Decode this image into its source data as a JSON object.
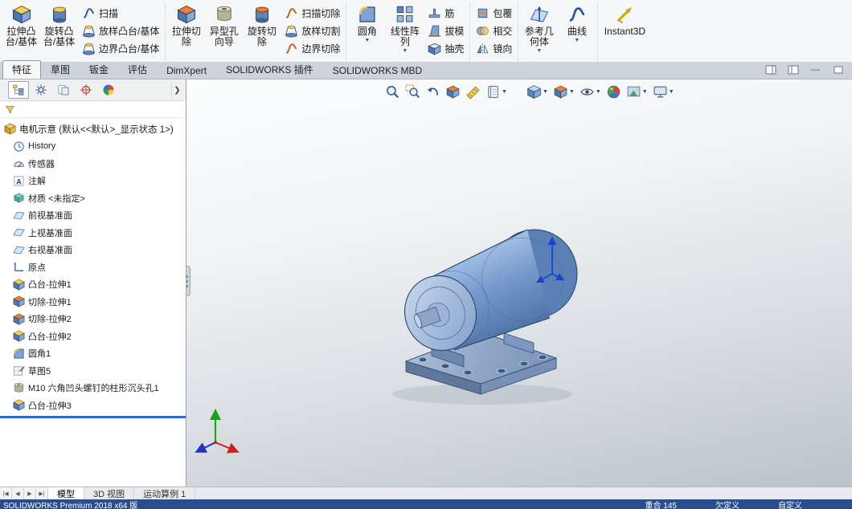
{
  "ribbon": {
    "groups": [
      {
        "big": [
          {
            "label": "拉伸凸台/基体",
            "icon": "extruded-boss-icon"
          },
          {
            "label": "旋转凸台/基体",
            "icon": "revolved-boss-icon"
          }
        ],
        "small": [
          {
            "label": "扫描",
            "icon": "sweep-icon"
          },
          {
            "label": "放样凸台/基体",
            "icon": "lofted-boss-icon"
          },
          {
            "label": "边界凸台/基体",
            "icon": "boundary-boss-icon"
          }
        ]
      },
      {
        "big": [
          {
            "label": "拉伸切除",
            "icon": "extruded-cut-icon"
          },
          {
            "label": "异型孔向导",
            "icon": "hole-wizard-icon"
          },
          {
            "label": "旋转切除",
            "icon": "revolved-cut-icon"
          }
        ],
        "small": [
          {
            "label": "扫描切除",
            "icon": "swept-cut-icon"
          },
          {
            "label": "放样切割",
            "icon": "lofted-cut-icon"
          },
          {
            "label": "边界切除",
            "icon": "boundary-cut-icon"
          }
        ]
      },
      {
        "big": [
          {
            "label": "圆角",
            "icon": "fillet-icon",
            "dropdown": true
          },
          {
            "label": "线性阵列",
            "icon": "linear-pattern-icon",
            "dropdown": true
          }
        ],
        "small": [
          {
            "label": "筋",
            "icon": "rib-icon"
          },
          {
            "label": "拔模",
            "icon": "draft-icon"
          },
          {
            "label": "抽壳",
            "icon": "shell-icon"
          }
        ]
      },
      {
        "small": [
          {
            "label": "包覆",
            "icon": "wrap-icon"
          },
          {
            "label": "相交",
            "icon": "intersect-icon"
          },
          {
            "label": "镜向",
            "icon": "mirror-icon"
          }
        ]
      },
      {
        "big": [
          {
            "label": "参考几何体",
            "icon": "reference-geometry-icon",
            "dropdown": true
          },
          {
            "label": "曲线",
            "icon": "curves-icon",
            "dropdown": true
          }
        ]
      },
      {
        "big": [
          {
            "label": "Instant3D",
            "icon": "instant3d-icon"
          }
        ]
      }
    ]
  },
  "command_tabs": [
    {
      "label": "特征",
      "active": true
    },
    {
      "label": "草图"
    },
    {
      "label": "钣金"
    },
    {
      "label": "评估"
    },
    {
      "label": "DimXpert"
    },
    {
      "label": "SOLIDWORKS 插件"
    },
    {
      "label": "SOLIDWORKS MBD"
    }
  ],
  "window_icons": [
    "pane-split-left-icon",
    "pane-split-right-icon",
    "minimize-icon",
    "pane-restore-icon"
  ],
  "panel_tab_icons": [
    "featuremanager-tree-tab",
    "propertymanager-tab",
    "configurationmanager-tab",
    "dimxpertmanager-tab",
    "displaymanager-tab"
  ],
  "feature_tree": {
    "root": "电机示意 (默认<<默认>_显示状态 1>)",
    "items": [
      {
        "label": "History",
        "icon": "history-icon"
      },
      {
        "label": "传感器",
        "icon": "sensors-icon"
      },
      {
        "label": "注解",
        "icon": "annotations-icon"
      },
      {
        "label": "材质 <未指定>",
        "icon": "material-icon"
      },
      {
        "label": "前视基准面",
        "icon": "plane-icon"
      },
      {
        "label": "上视基准面",
        "icon": "plane-icon"
      },
      {
        "label": "右视基准面",
        "icon": "plane-icon"
      },
      {
        "label": "原点",
        "icon": "origin-icon"
      },
      {
        "label": "凸台-拉伸1",
        "icon": "boss-extrude-icon"
      },
      {
        "label": "切除-拉伸1",
        "icon": "cut-extrude-icon"
      },
      {
        "label": "切除-拉伸2",
        "icon": "cut-extrude-icon"
      },
      {
        "label": "凸台-拉伸2",
        "icon": "boss-extrude-icon"
      },
      {
        "label": "圆角1",
        "icon": "fillet-feature-icon"
      },
      {
        "label": "草图5",
        "icon": "sketch-icon"
      },
      {
        "label": "M10 六角凹头螺钉的柱形沉头孔1",
        "icon": "counterbore-hole-icon"
      },
      {
        "label": "凸台-拉伸3",
        "icon": "boss-extrude-icon"
      }
    ]
  },
  "hud_icons": [
    "zoom-to-fit",
    "zoom-to-area",
    "previous-view",
    "section-view",
    "measure",
    "mass-properties",
    "view-orientation",
    "display-style",
    "hide-show-items",
    "edit-appearance",
    "apply-scene",
    "view-settings"
  ],
  "bottom_tabs": [
    {
      "label": "模型",
      "active": true
    },
    {
      "label": "3D 视图"
    },
    {
      "label": "运动算例 1"
    }
  ],
  "status_bar": {
    "left": "SOLIDWORKS Premium 2018 x64 版",
    "items": [
      "重合 145",
      "欠定义",
      "自定义"
    ]
  },
  "colors": {
    "accent_blue": "#2a6bc8",
    "status_bar_blue": "#2a4d8f",
    "motor_body_blue": "#7396cb",
    "viewport_gray": "#bcc2c9"
  }
}
